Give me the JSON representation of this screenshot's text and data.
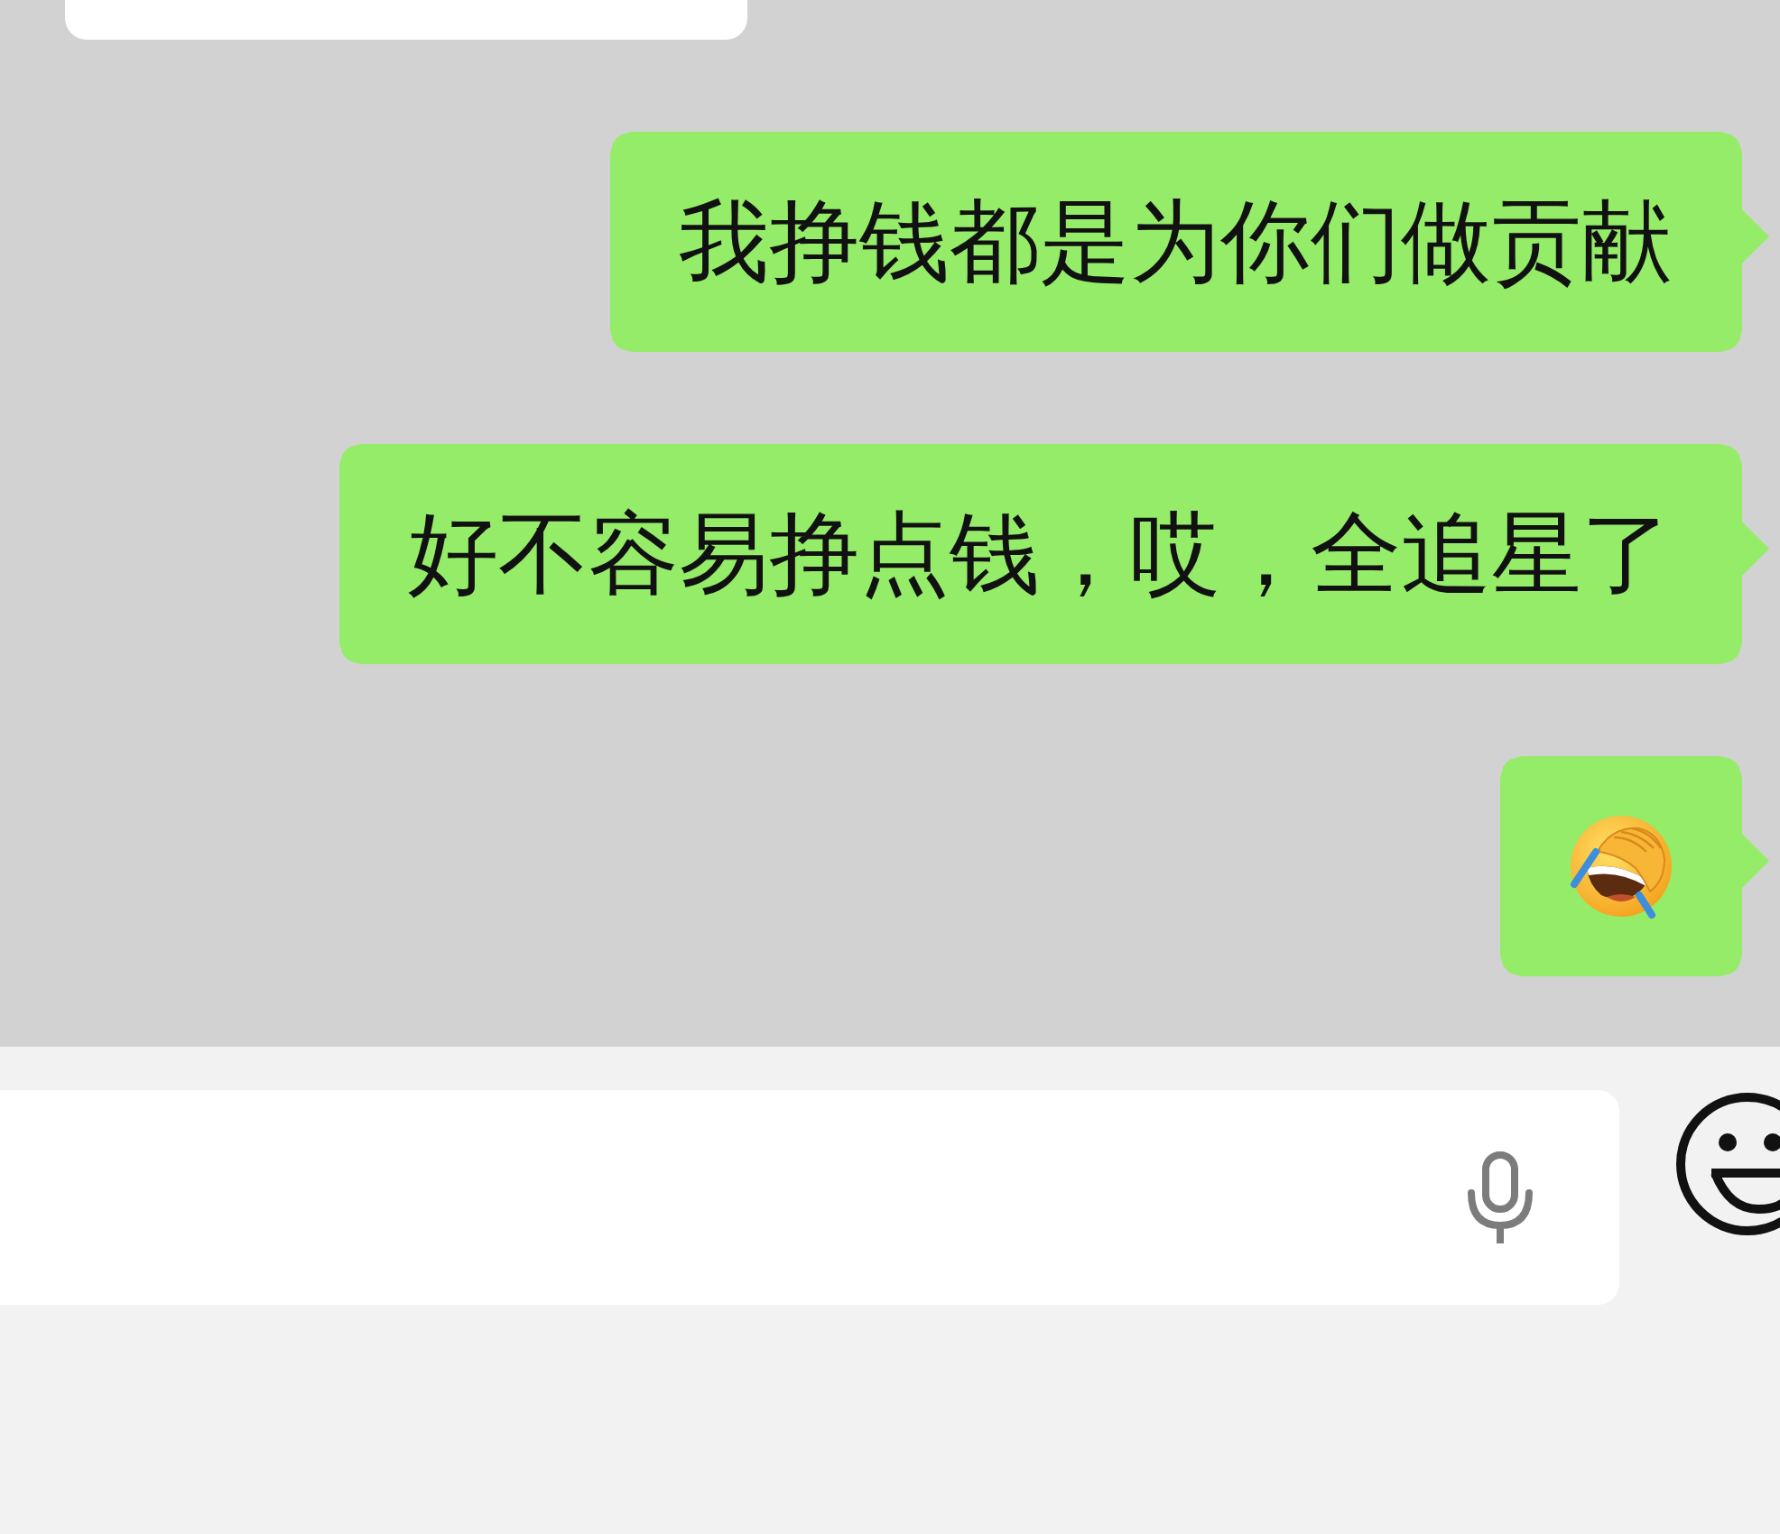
{
  "chat": {
    "messages": [
      {
        "kind": "cut_off",
        "outgoing": false
      },
      {
        "kind": "text",
        "outgoing": true,
        "text": "我挣钱都是为你们做贡献"
      },
      {
        "kind": "text",
        "outgoing": true,
        "text": "好不容易挣点钱，哎，全追星了"
      },
      {
        "kind": "emoji",
        "outgoing": true
      }
    ]
  }
}
